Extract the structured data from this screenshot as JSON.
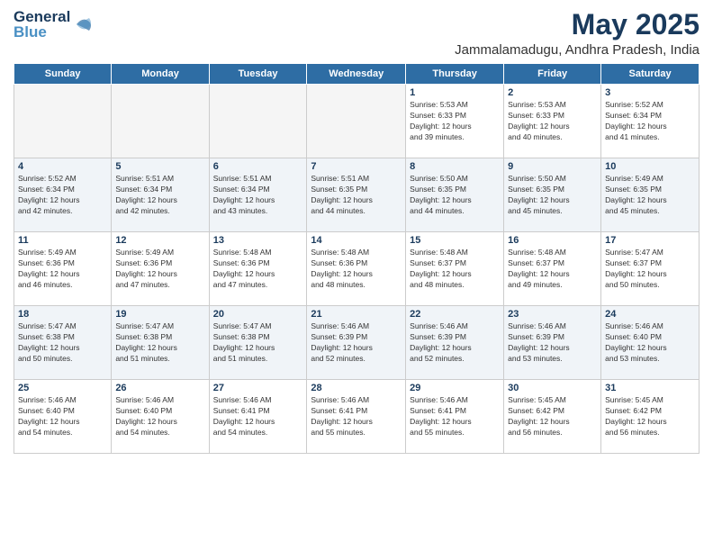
{
  "header": {
    "logo_line1": "General",
    "logo_line2": "Blue",
    "title": "May 2025",
    "subtitle": "Jammalamadugu, Andhra Pradesh, India"
  },
  "days_of_week": [
    "Sunday",
    "Monday",
    "Tuesday",
    "Wednesday",
    "Thursday",
    "Friday",
    "Saturday"
  ],
  "weeks": [
    [
      {
        "day": "",
        "info": ""
      },
      {
        "day": "",
        "info": ""
      },
      {
        "day": "",
        "info": ""
      },
      {
        "day": "",
        "info": ""
      },
      {
        "day": "1",
        "info": "Sunrise: 5:53 AM\nSunset: 6:33 PM\nDaylight: 12 hours\nand 39 minutes."
      },
      {
        "day": "2",
        "info": "Sunrise: 5:53 AM\nSunset: 6:33 PM\nDaylight: 12 hours\nand 40 minutes."
      },
      {
        "day": "3",
        "info": "Sunrise: 5:52 AM\nSunset: 6:34 PM\nDaylight: 12 hours\nand 41 minutes."
      }
    ],
    [
      {
        "day": "4",
        "info": "Sunrise: 5:52 AM\nSunset: 6:34 PM\nDaylight: 12 hours\nand 42 minutes."
      },
      {
        "day": "5",
        "info": "Sunrise: 5:51 AM\nSunset: 6:34 PM\nDaylight: 12 hours\nand 42 minutes."
      },
      {
        "day": "6",
        "info": "Sunrise: 5:51 AM\nSunset: 6:34 PM\nDaylight: 12 hours\nand 43 minutes."
      },
      {
        "day": "7",
        "info": "Sunrise: 5:51 AM\nSunset: 6:35 PM\nDaylight: 12 hours\nand 44 minutes."
      },
      {
        "day": "8",
        "info": "Sunrise: 5:50 AM\nSunset: 6:35 PM\nDaylight: 12 hours\nand 44 minutes."
      },
      {
        "day": "9",
        "info": "Sunrise: 5:50 AM\nSunset: 6:35 PM\nDaylight: 12 hours\nand 45 minutes."
      },
      {
        "day": "10",
        "info": "Sunrise: 5:49 AM\nSunset: 6:35 PM\nDaylight: 12 hours\nand 45 minutes."
      }
    ],
    [
      {
        "day": "11",
        "info": "Sunrise: 5:49 AM\nSunset: 6:36 PM\nDaylight: 12 hours\nand 46 minutes."
      },
      {
        "day": "12",
        "info": "Sunrise: 5:49 AM\nSunset: 6:36 PM\nDaylight: 12 hours\nand 47 minutes."
      },
      {
        "day": "13",
        "info": "Sunrise: 5:48 AM\nSunset: 6:36 PM\nDaylight: 12 hours\nand 47 minutes."
      },
      {
        "day": "14",
        "info": "Sunrise: 5:48 AM\nSunset: 6:36 PM\nDaylight: 12 hours\nand 48 minutes."
      },
      {
        "day": "15",
        "info": "Sunrise: 5:48 AM\nSunset: 6:37 PM\nDaylight: 12 hours\nand 48 minutes."
      },
      {
        "day": "16",
        "info": "Sunrise: 5:48 AM\nSunset: 6:37 PM\nDaylight: 12 hours\nand 49 minutes."
      },
      {
        "day": "17",
        "info": "Sunrise: 5:47 AM\nSunset: 6:37 PM\nDaylight: 12 hours\nand 50 minutes."
      }
    ],
    [
      {
        "day": "18",
        "info": "Sunrise: 5:47 AM\nSunset: 6:38 PM\nDaylight: 12 hours\nand 50 minutes."
      },
      {
        "day": "19",
        "info": "Sunrise: 5:47 AM\nSunset: 6:38 PM\nDaylight: 12 hours\nand 51 minutes."
      },
      {
        "day": "20",
        "info": "Sunrise: 5:47 AM\nSunset: 6:38 PM\nDaylight: 12 hours\nand 51 minutes."
      },
      {
        "day": "21",
        "info": "Sunrise: 5:46 AM\nSunset: 6:39 PM\nDaylight: 12 hours\nand 52 minutes."
      },
      {
        "day": "22",
        "info": "Sunrise: 5:46 AM\nSunset: 6:39 PM\nDaylight: 12 hours\nand 52 minutes."
      },
      {
        "day": "23",
        "info": "Sunrise: 5:46 AM\nSunset: 6:39 PM\nDaylight: 12 hours\nand 53 minutes."
      },
      {
        "day": "24",
        "info": "Sunrise: 5:46 AM\nSunset: 6:40 PM\nDaylight: 12 hours\nand 53 minutes."
      }
    ],
    [
      {
        "day": "25",
        "info": "Sunrise: 5:46 AM\nSunset: 6:40 PM\nDaylight: 12 hours\nand 54 minutes."
      },
      {
        "day": "26",
        "info": "Sunrise: 5:46 AM\nSunset: 6:40 PM\nDaylight: 12 hours\nand 54 minutes."
      },
      {
        "day": "27",
        "info": "Sunrise: 5:46 AM\nSunset: 6:41 PM\nDaylight: 12 hours\nand 54 minutes."
      },
      {
        "day": "28",
        "info": "Sunrise: 5:46 AM\nSunset: 6:41 PM\nDaylight: 12 hours\nand 55 minutes."
      },
      {
        "day": "29",
        "info": "Sunrise: 5:46 AM\nSunset: 6:41 PM\nDaylight: 12 hours\nand 55 minutes."
      },
      {
        "day": "30",
        "info": "Sunrise: 5:45 AM\nSunset: 6:42 PM\nDaylight: 12 hours\nand 56 minutes."
      },
      {
        "day": "31",
        "info": "Sunrise: 5:45 AM\nSunset: 6:42 PM\nDaylight: 12 hours\nand 56 minutes."
      }
    ]
  ]
}
